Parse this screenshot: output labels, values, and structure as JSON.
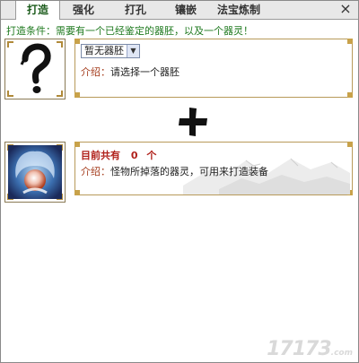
{
  "tabs": [
    {
      "label": "打造",
      "active": true
    },
    {
      "label": "强化",
      "active": false
    },
    {
      "label": "打孔",
      "active": false
    },
    {
      "label": "镶嵌",
      "active": false
    },
    {
      "label": "法宝炼制",
      "active": false
    }
  ],
  "close_label": "×",
  "condition_text": "打造条件：需要有一个已经鉴定的器胚，以及一个器灵！",
  "embryo": {
    "icon": "question-mark-icon",
    "select_value": "暂无器胚",
    "intro_label": "介绍：",
    "intro_text": "请选择一个器胚"
  },
  "spirit": {
    "icon": "spirit-orb-icon",
    "count_label": "目前共有",
    "count_value": "0",
    "count_unit": "个",
    "intro_label": "介绍：",
    "intro_text": "怪物所掉落的器灵，可用来打造装备"
  },
  "plus_icon": "plus-icon",
  "watermark": {
    "main": "17173",
    "sub": ".com"
  },
  "colors": {
    "condition": "#1f7a1f",
    "count": "#b0201a",
    "intro_label": "#a33a1a",
    "frame": "#c8a24a"
  }
}
